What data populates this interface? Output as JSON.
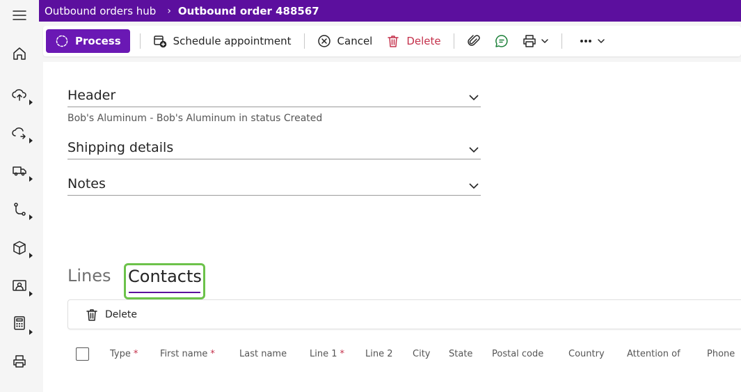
{
  "breadcrumb": {
    "parent": "Outbound orders hub",
    "separator": "›",
    "current": "Outbound order 488567"
  },
  "toolbar": {
    "process": "Process",
    "schedule": "Schedule appointment",
    "cancel": "Cancel",
    "delete": "Delete"
  },
  "sections": [
    {
      "title": "Header",
      "summary": "Bob's Aluminum - Bob's Aluminum in status Created"
    },
    {
      "title": "Shipping details"
    },
    {
      "title": "Notes"
    }
  ],
  "tabs": {
    "lines": "Lines",
    "contacts": "Contacts",
    "selected": "contacts"
  },
  "grid_toolbar": {
    "delete": "Delete"
  },
  "columns": [
    {
      "label": "Type",
      "required": "*"
    },
    {
      "label": "First name",
      "required": "*"
    },
    {
      "label": "Last name"
    },
    {
      "label": "Line 1",
      "required": "*"
    },
    {
      "label": "Line 2"
    },
    {
      "label": "City"
    },
    {
      "label": "State"
    },
    {
      "label": "Postal code"
    },
    {
      "label": "Country"
    },
    {
      "label": "Attention of"
    },
    {
      "label": "Phone"
    }
  ],
  "colors": {
    "topbar": "#5c0f9e",
    "primary_button": "#6a18b4",
    "focus_outline": "#6cc24a",
    "danger": "#c4314b"
  },
  "icons": [
    "hamburger-icon",
    "home-icon",
    "upload-icon",
    "refresh-icon",
    "truck-icon",
    "route-icon",
    "box-icon",
    "contact-card-icon",
    "calculator-icon",
    "printer-icon"
  ]
}
